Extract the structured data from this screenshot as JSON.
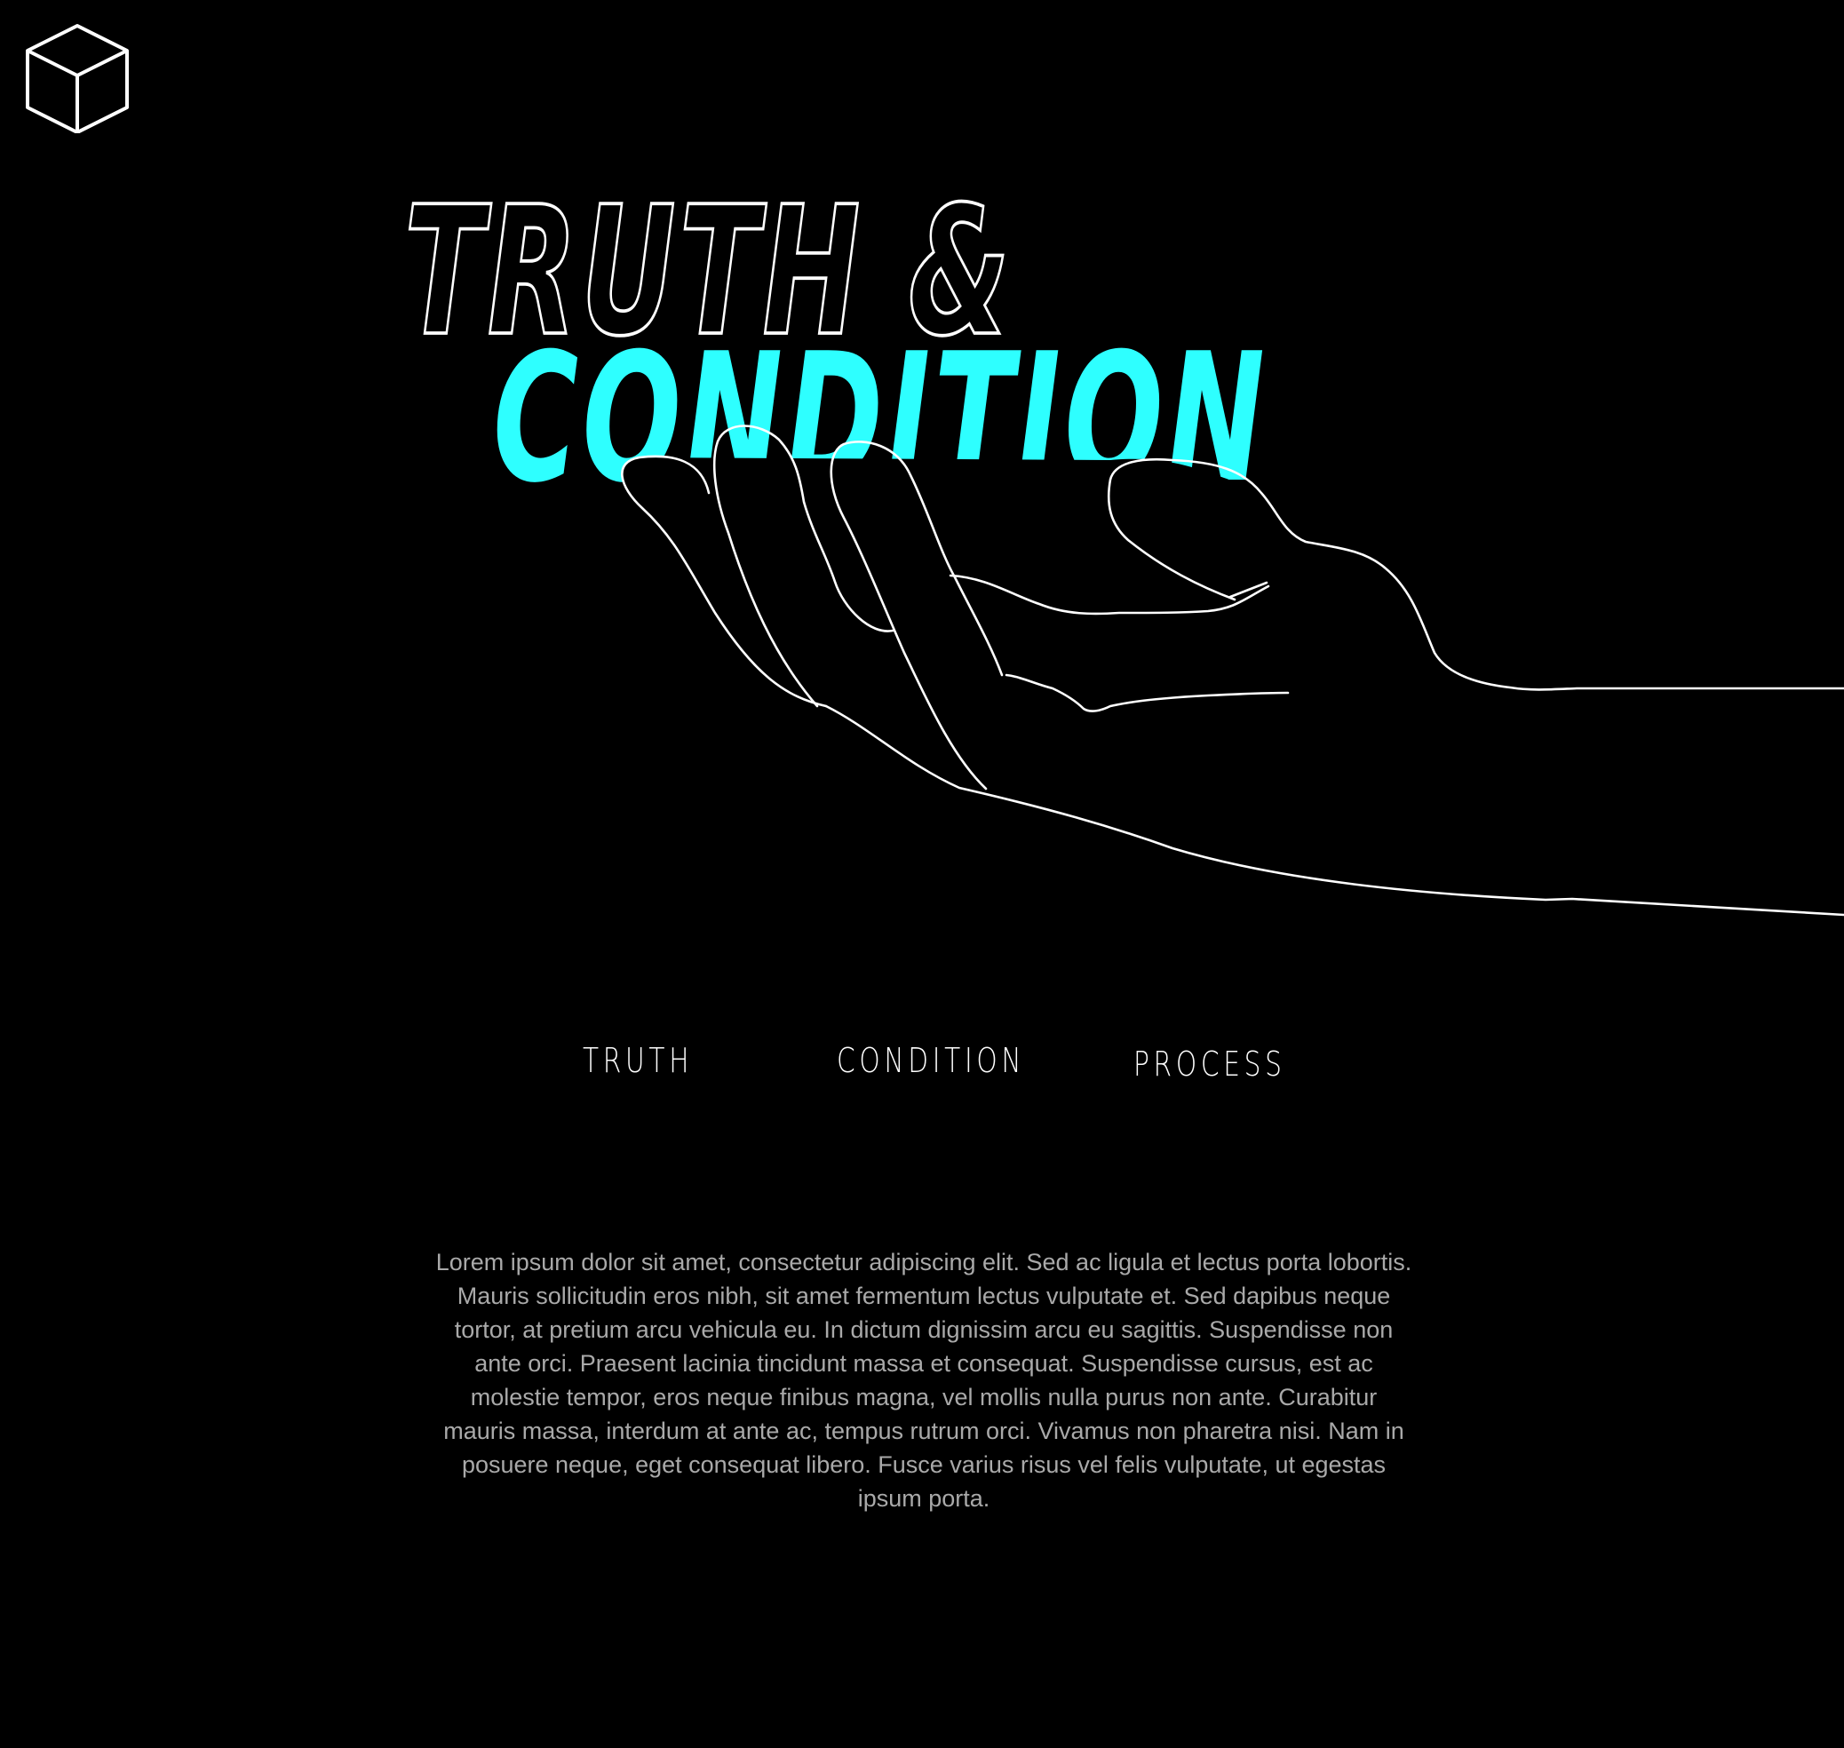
{
  "brand": {
    "logo_icon": "cube-icon"
  },
  "hero": {
    "title_line1": "TRUTH &",
    "title_line2": "CONDITION",
    "accent_color": "#2effff",
    "illustration": "open-hand-icon"
  },
  "nav": {
    "items": [
      {
        "label": "TRUTH"
      },
      {
        "label": "CONDITION"
      },
      {
        "label": "PROCESS"
      }
    ]
  },
  "content": {
    "paragraph": "Lorem ipsum dolor sit amet, consectetur adipiscing elit. Sed ac ligula et lectus porta lobortis. Mauris sollicitudin eros nibh, sit amet fermentum lectus vulputate et. Sed dapibus neque tortor, at pretium arcu vehicula eu. In dictum dignissim arcu eu sagittis. Suspendisse non ante orci. Praesent lacinia tincidunt massa et consequat. Suspendisse cursus, est ac molestie tempor, eros neque finibus magna, vel mollis nulla purus non ante. Curabitur mauris massa, interdum at ante ac, tempus rutrum orci. Vivamus non pharetra nisi. Nam in posuere neque, eget consequat libero. Fusce varius risus vel felis vulputate, ut egestas ipsum porta."
  }
}
